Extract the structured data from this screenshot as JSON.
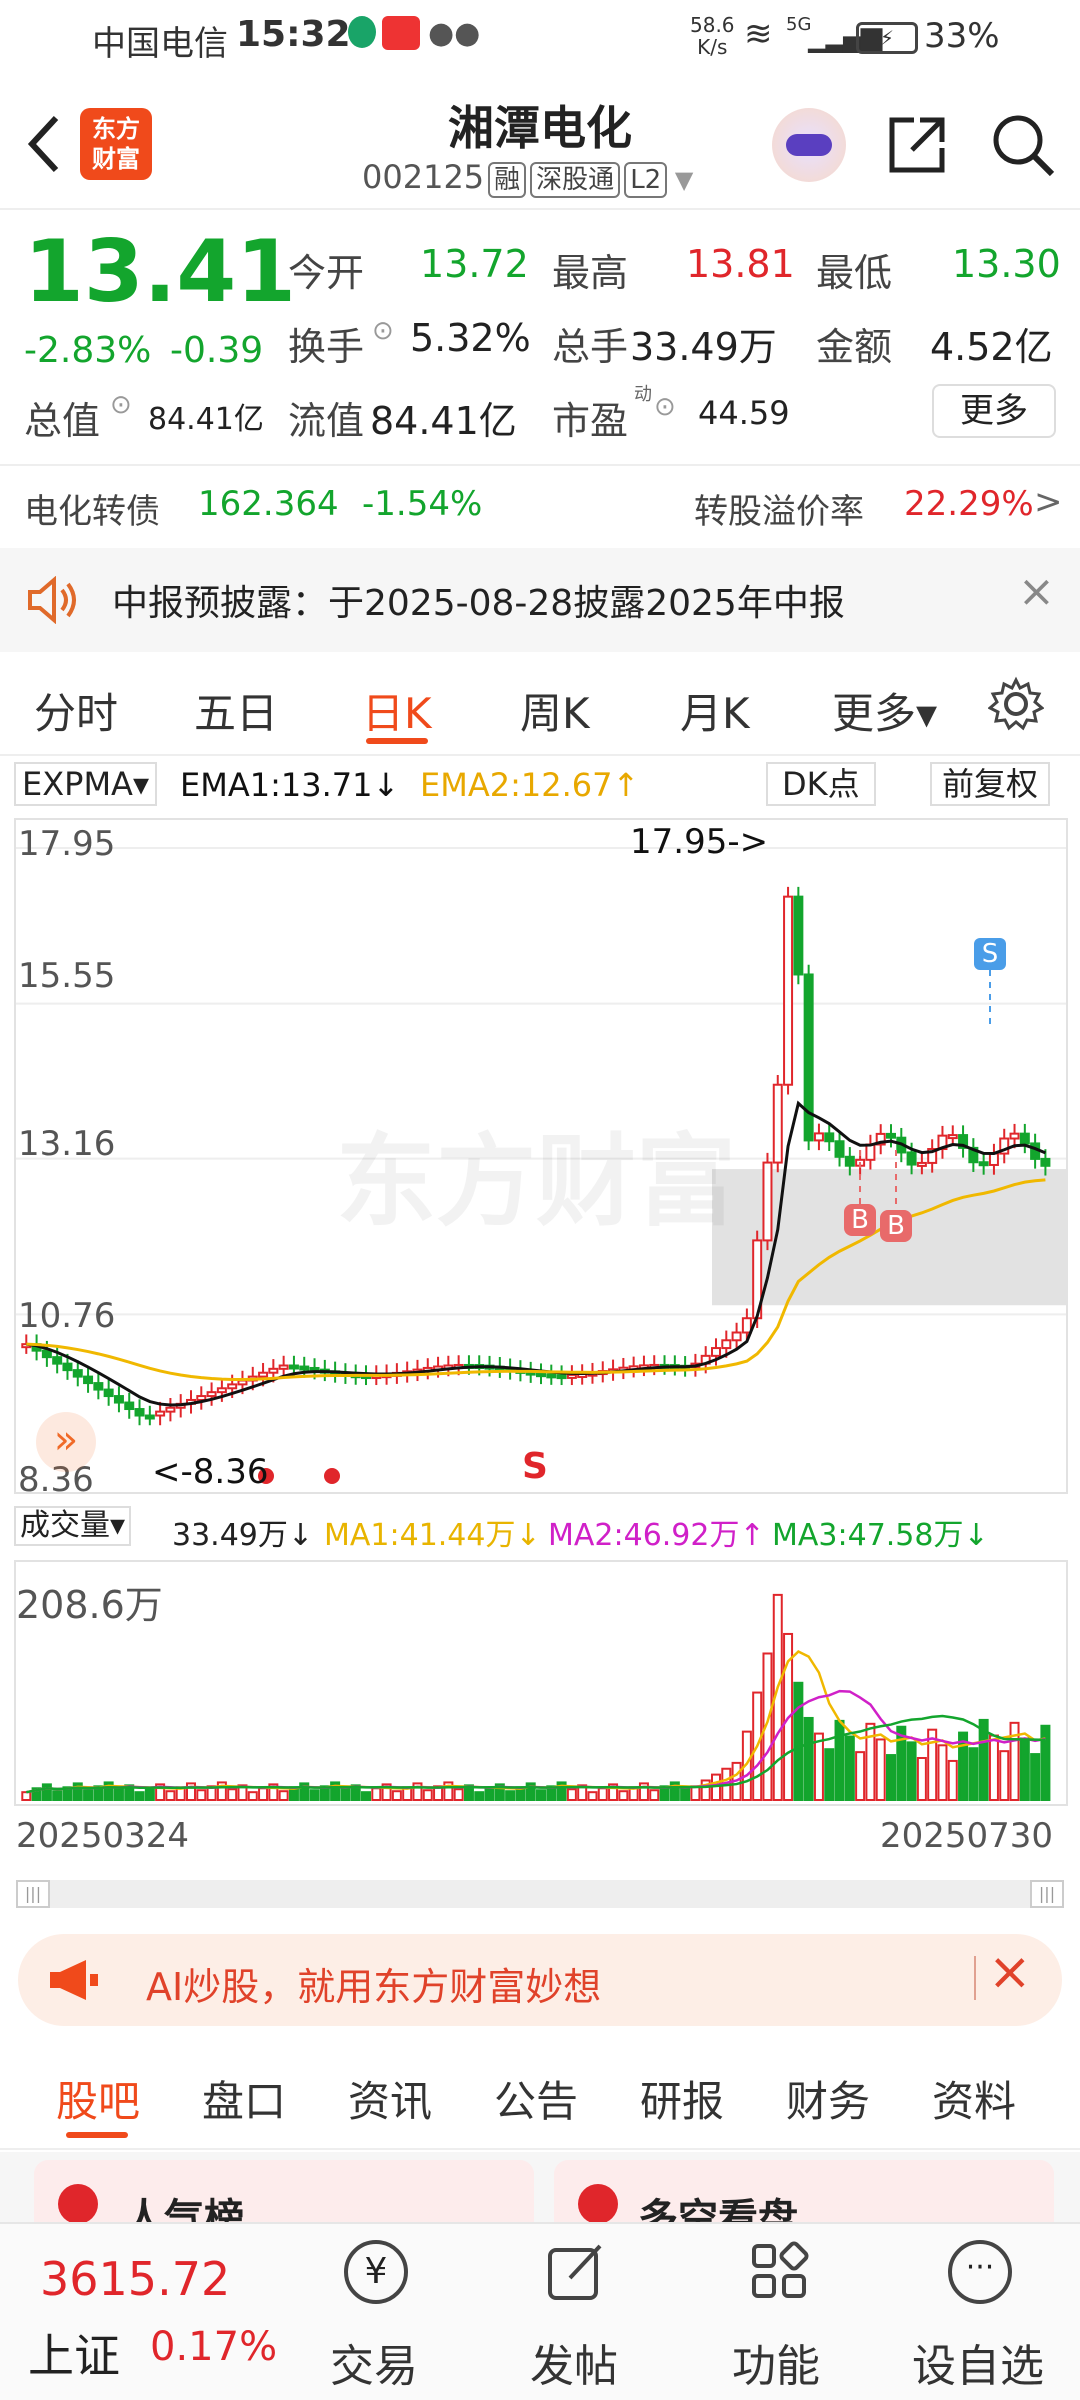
{
  "status_bar": {
    "carrier": "中国电信",
    "time": "15:32",
    "net_speed": "58.6",
    "net_unit": "K/s",
    "signal": "5G",
    "battery": "33%"
  },
  "header": {
    "title": "湘潭电化",
    "code": "002125",
    "tags": [
      "融",
      "深股通",
      "L2"
    ]
  },
  "quote": {
    "price": "13.41",
    "change_pct": "-2.83%",
    "change": "-0.39",
    "open_label": "今开",
    "open": "13.72",
    "high_label": "最高",
    "high": "13.81",
    "low_label": "最低",
    "low": "13.30",
    "turnover_label": "换手",
    "turnover": "5.32%",
    "volume_label": "总手",
    "volume": "33.49万",
    "amount_label": "金额",
    "amount": "4.52亿",
    "mktcap_label": "总值",
    "mktcap": "84.41亿",
    "float_label": "流值",
    "float": "84.41亿",
    "pe_label": "市盈",
    "pe_sup": "动",
    "pe": "44.59",
    "more_label": "更多"
  },
  "bond": {
    "name": "电化转债",
    "price": "162.364",
    "change": "-1.54%",
    "premium_label": "转股溢价率",
    "premium": "22.29%",
    "arrow": ">"
  },
  "notice": {
    "text": "中报预披露：于2025-08-28披露2025年中报"
  },
  "period_tabs": [
    "分时",
    "五日",
    "日K",
    "周K",
    "月K",
    "更多▾"
  ],
  "active_period": "日K",
  "indicator": {
    "name": "EXPMA▾",
    "ema1": "EMA1:13.71↓",
    "ema2": "EMA2:12.67↑",
    "dk": "DK点",
    "adjust": "前复权"
  },
  "kchart": {
    "y_labels": [
      "17.95",
      "15.55",
      "13.16",
      "10.76",
      "8.36"
    ],
    "max_label": "17.95->",
    "min_label": "<-8.36",
    "signals": [
      "S",
      "B",
      "B",
      "S"
    ],
    "watermark": "东方财富"
  },
  "volume": {
    "name": "成交量▾",
    "value": "33.49万↓",
    "ma1": "MA1:41.44万↓",
    "ma2": "MA2:46.92万↑",
    "ma3": "MA3:47.58万↓",
    "max_label": "208.6万",
    "start_date": "20250324",
    "end_date": "20250730"
  },
  "banner": {
    "text": "AI炒股，就用东方财富妙想"
  },
  "bottom_tabs": [
    "股吧",
    "盘口",
    "资讯",
    "公告",
    "研报",
    "财务",
    "资料"
  ],
  "active_bottom": "股吧",
  "cards": [
    "人气榜",
    "多空看盘"
  ],
  "nav": {
    "index_value": "3615.72",
    "index_name": "上证",
    "index_change": "0.17%",
    "items": [
      "交易",
      "发帖",
      "功能",
      "设自选"
    ]
  },
  "chart_data": {
    "type": "candlestick",
    "ylim": [
      8.36,
      17.95
    ],
    "max": 17.95,
    "min": 8.36,
    "ema1": 13.71,
    "ema2": 12.67,
    "volume_max": "208.6万"
  },
  "colors": {
    "up": "#e0262b",
    "down": "#13a52d",
    "accent": "#f04a1b",
    "ema1": "#111111",
    "ema2": "#f0b800",
    "ma2": "#d020c8",
    "ma3": "#13a52d"
  }
}
